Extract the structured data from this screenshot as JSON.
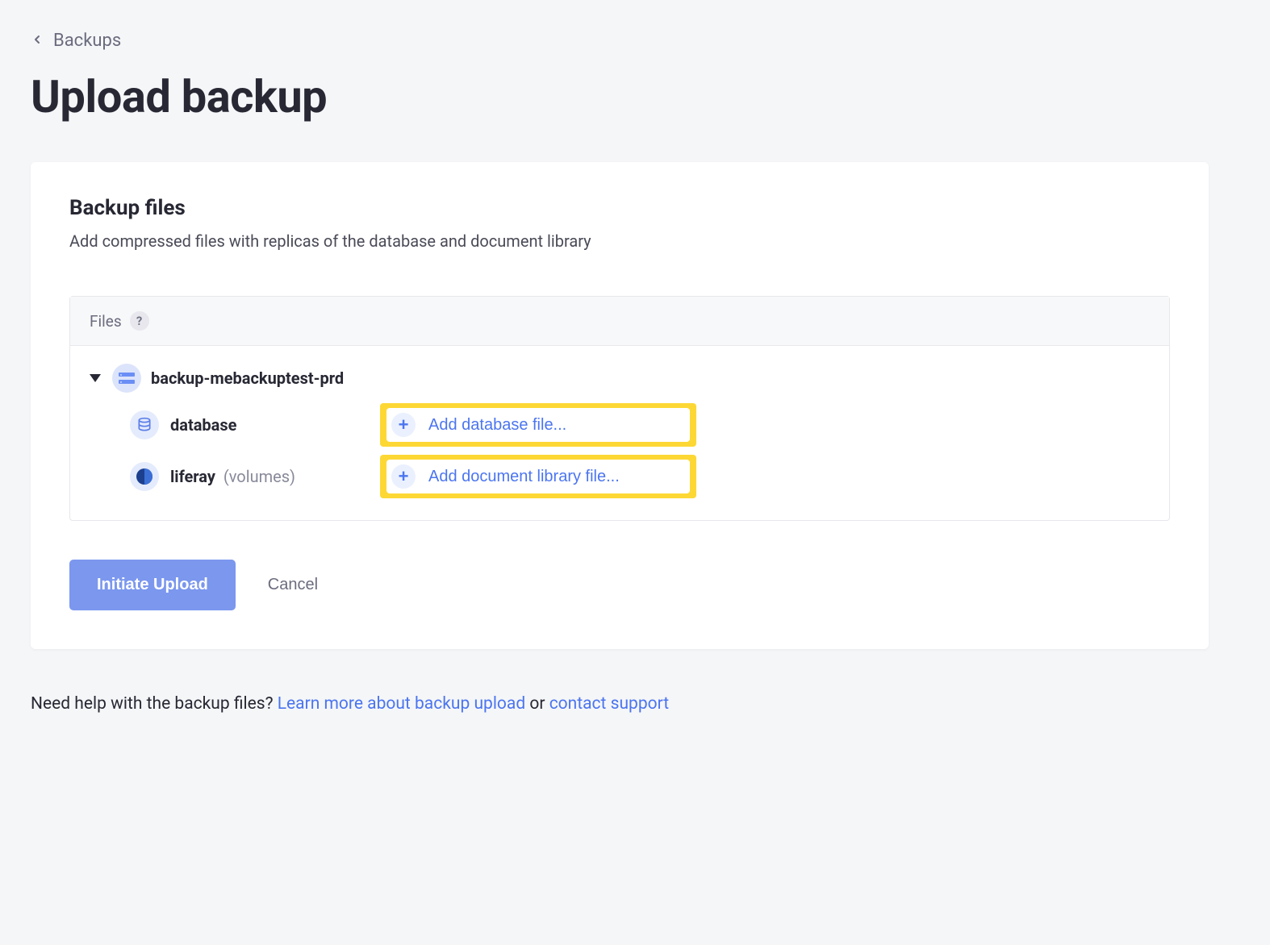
{
  "breadcrumb": {
    "label": "Backups"
  },
  "page": {
    "title": "Upload backup"
  },
  "section": {
    "title": "Backup files",
    "description": "Add compressed files with replicas of the database and document library"
  },
  "filesBox": {
    "headerLabel": "Files",
    "helpSymbol": "?"
  },
  "tree": {
    "root": {
      "name": "backup-mebackuptest-prd"
    },
    "children": [
      {
        "label": "database",
        "sublabel": "",
        "addLabel": "Add database file..."
      },
      {
        "label": "liferay",
        "sublabel": "(volumes)",
        "addLabel": "Add document library file..."
      }
    ]
  },
  "actions": {
    "primary": "Initiate Upload",
    "cancel": "Cancel"
  },
  "help": {
    "prefix": "Need help with the backup files? ",
    "learnMore": "Learn more about backup upload",
    "middle": " or ",
    "contact": "contact support"
  }
}
